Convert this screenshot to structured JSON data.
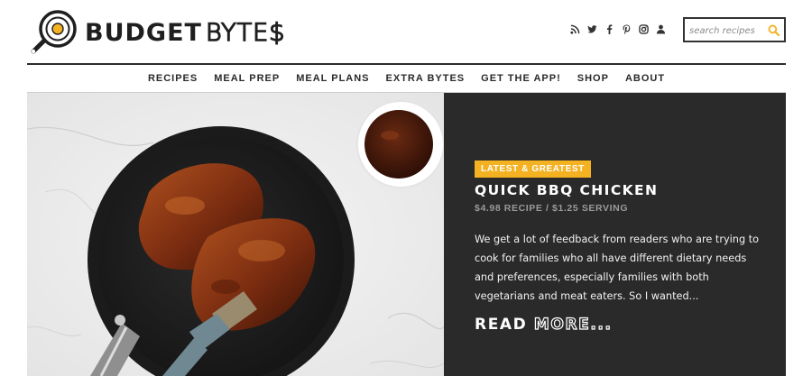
{
  "brand": {
    "name_bold": "BUDGET",
    "name_outline": "BYTE$"
  },
  "social": {
    "icons": [
      "rss-icon",
      "twitter-icon",
      "facebook-icon",
      "pinterest-icon",
      "instagram-icon",
      "user-icon"
    ]
  },
  "search": {
    "placeholder": "search recipes",
    "value": "",
    "icon": "search-icon",
    "icon_color": "#f4b223"
  },
  "nav": {
    "items": [
      {
        "label": "RECIPES"
      },
      {
        "label": "MEAL PREP"
      },
      {
        "label": "MEAL PLANS"
      },
      {
        "label": "EXTRA BYTES"
      },
      {
        "label": "GET THE APP!"
      },
      {
        "label": "SHOP"
      },
      {
        "label": "ABOUT"
      }
    ]
  },
  "featured": {
    "image": "bbq-chicken-in-skillet-photo",
    "badge": "LATEST & GREATEST",
    "title": "QUICK BBQ CHICKEN",
    "meta": "$4.98 RECIPE / $1.25 SERVING",
    "excerpt": "We get a lot of feedback from readers who are trying to cook for families who all have different dietary needs and preferences, especially families with both vegetarians and meat eaters. So I wanted...",
    "read_more_solid": "READ",
    "read_more_outline": "MORE...",
    "colors": {
      "panel": "#2a2a2a",
      "badge": "#f4b223",
      "meta": "#9a9a9a"
    }
  }
}
